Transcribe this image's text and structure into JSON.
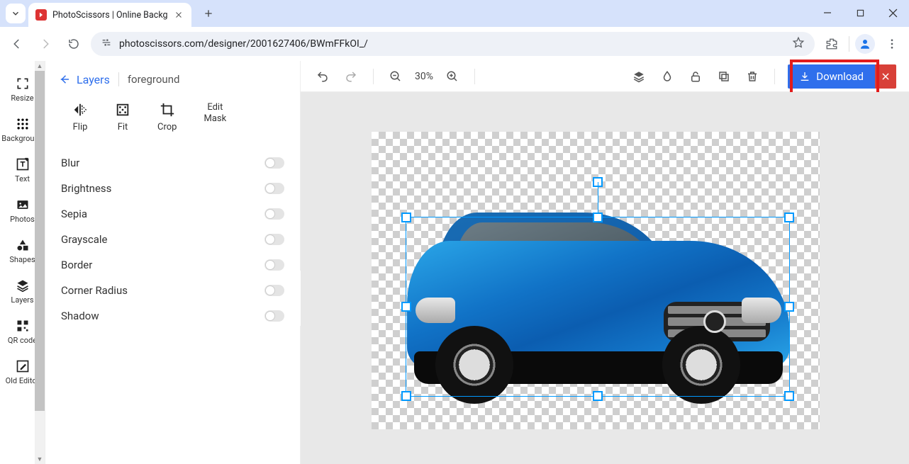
{
  "browser": {
    "tab_title": "PhotoScissors | Online Backgro",
    "url": "photoscissors.com/designer/2001627406/BWmFFkOI_/"
  },
  "left_rail": {
    "items": [
      {
        "label": "Resize"
      },
      {
        "label": "Background"
      },
      {
        "label": "Text"
      },
      {
        "label": "Photos"
      },
      {
        "label": "Shapes"
      },
      {
        "label": "Layers"
      },
      {
        "label": "QR code"
      },
      {
        "label": "Old Editor"
      }
    ]
  },
  "panel": {
    "back_label": "Layers",
    "layer_name": "foreground",
    "tools": {
      "flip": "Flip",
      "fit": "Fit",
      "crop": "Crop",
      "edit_mask": "Edit\nMask"
    },
    "options": [
      {
        "label": "Blur"
      },
      {
        "label": "Brightness"
      },
      {
        "label": "Sepia"
      },
      {
        "label": "Grayscale"
      },
      {
        "label": "Border"
      },
      {
        "label": "Corner Radius"
      },
      {
        "label": "Shadow"
      }
    ]
  },
  "topbar": {
    "zoom_label": "30%",
    "download_label": "Download"
  }
}
